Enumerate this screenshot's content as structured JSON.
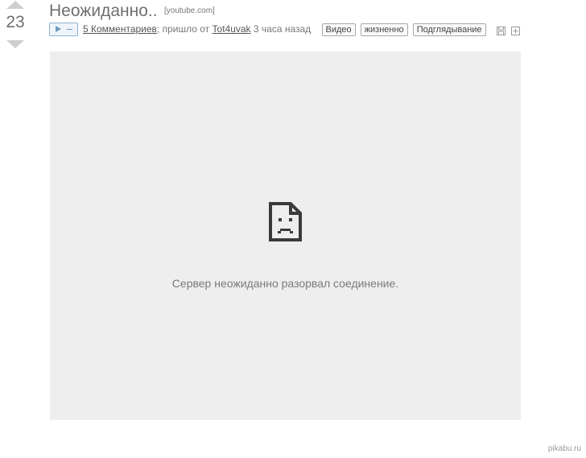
{
  "vote": {
    "count": "23"
  },
  "post": {
    "title": "Неожиданно..",
    "source": "[youtube.com]"
  },
  "meta": {
    "comments_link": "5 Комментариев",
    "separator": "; пришло от",
    "author": "Tot4uvak",
    "time": "3 часа назад"
  },
  "tags": [
    "Видео",
    "жизненно",
    "Подглядывание"
  ],
  "embed": {
    "error_message": "Сервер неожиданно разорвал соединение."
  },
  "watermark": "pikabu.ru",
  "icons": {
    "save": "save-icon",
    "add": "plus-icon",
    "error": "sad-file-icon",
    "play": "play-icon"
  },
  "colors": {
    "embed_bg": "#eeeeee",
    "accent_blue": "#6e9ac0"
  }
}
